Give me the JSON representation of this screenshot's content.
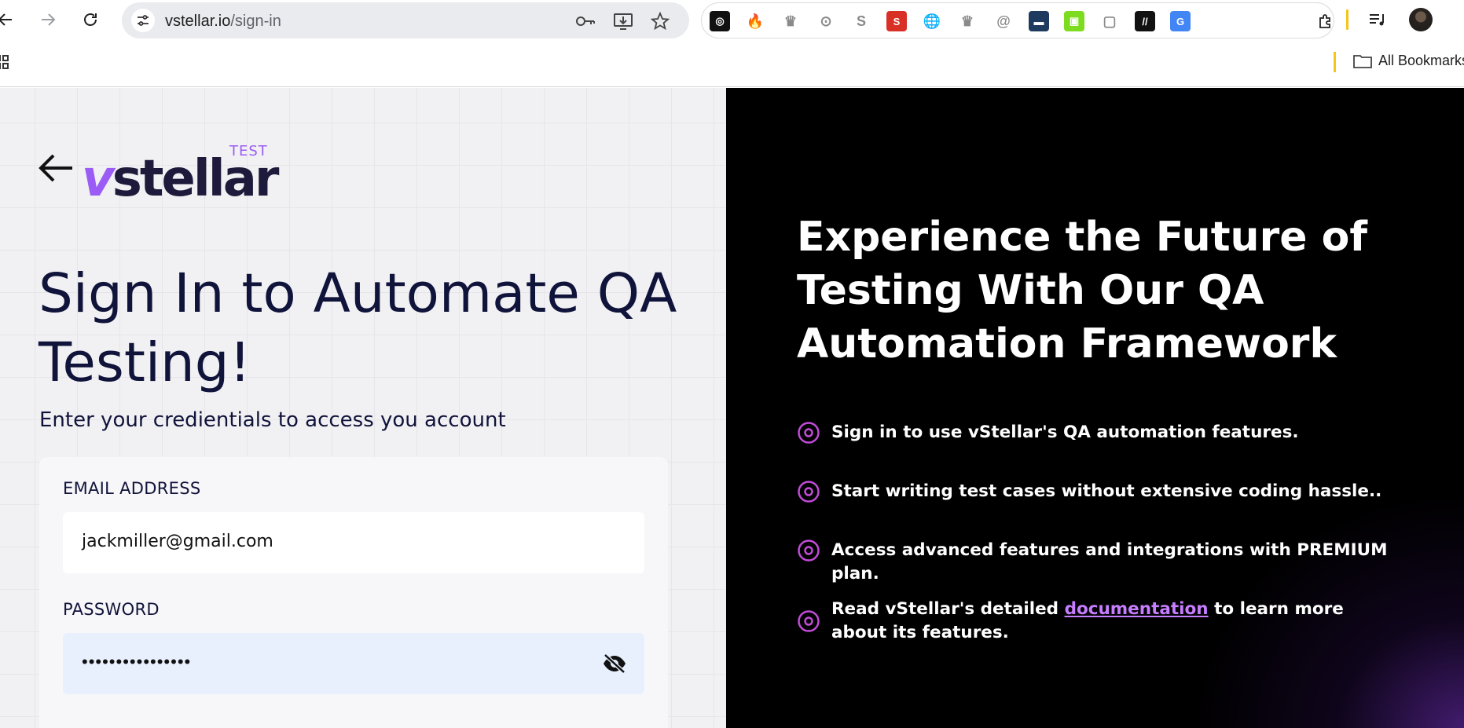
{
  "browser": {
    "url_host": "vstellar.io",
    "url_path": "/sign-in",
    "bookmarks_folder": "All Bookmarks",
    "extensions": [
      {
        "name": "chatgpt-extension-icon",
        "bg": "#111111",
        "glyph": "◎"
      },
      {
        "name": "fire-extension-icon",
        "bg": "#ffffff",
        "glyph": "🔥"
      },
      {
        "name": "crown-extension-icon",
        "bg": "#ffffff",
        "glyph": "♛"
      },
      {
        "name": "location-extension-icon",
        "bg": "#ffffff",
        "glyph": "⊙"
      },
      {
        "name": "seo-quake-extension-icon",
        "bg": "#ffffff",
        "glyph": "S"
      },
      {
        "name": "seo-extension-icon",
        "bg": "#d93025",
        "glyph": "S"
      },
      {
        "name": "globe-extension-icon",
        "bg": "#ffffff",
        "glyph": "🌐"
      },
      {
        "name": "crown-extension-icon-2",
        "bg": "#ffffff",
        "glyph": "♛"
      },
      {
        "name": "at-extension-icon",
        "bg": "#ffffff",
        "glyph": "@"
      },
      {
        "name": "folder-extension-icon",
        "bg": "#1e3a5f",
        "glyph": "▬"
      },
      {
        "name": "grid-extension-icon",
        "bg": "#7ddc1f",
        "glyph": "▣"
      },
      {
        "name": "screen-record-extension-icon",
        "bg": "#ffffff",
        "glyph": "▢"
      },
      {
        "name": "slash-extension-icon",
        "bg": "#111111",
        "glyph": "//"
      },
      {
        "name": "google-translate-extension-icon",
        "bg": "#4285f4",
        "glyph": "G"
      }
    ]
  },
  "page": {
    "headline": "Sign In to Automate QA Testing!",
    "subhead": "Enter your credientials to access you account",
    "logo_word_v": "v",
    "logo_word_rest": "stellar",
    "logo_tag": "TEST",
    "form": {
      "email_label": "EMAIL ADDRESS",
      "email_value": "jackmiller@gmail.com",
      "password_label": "PASSWORD",
      "password_mask": "••••••••••••••••"
    },
    "promo": {
      "title": "Experience the Future of Testing With Our QA Automation Framework",
      "features": [
        "Sign in to use vStellar's QA automation features.",
        "Start writing test cases without extensive coding hassle..",
        "Access advanced features and integrations with PREMIUM plan."
      ],
      "feature_docs_prefix": "Read vStellar's detailed ",
      "feature_docs_link": "documentation",
      "feature_docs_suffix": " to learn more about its features."
    }
  },
  "colors": {
    "brand_purple": "#9b5cf6",
    "navy": "#10133a",
    "link_purple": "#c77dff",
    "autofill_blue": "#e8f0fe"
  }
}
